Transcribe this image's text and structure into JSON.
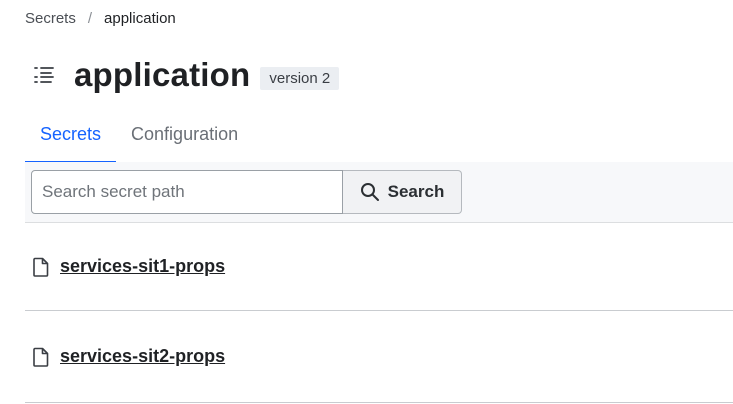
{
  "breadcrumb": {
    "root": "Secrets",
    "separator": "/",
    "current": "application"
  },
  "header": {
    "icon": "list-icon",
    "title": "application",
    "version_badge": "version 2"
  },
  "tabs": [
    {
      "label": "Secrets",
      "active": true
    },
    {
      "label": "Configuration",
      "active": false
    }
  ],
  "toolbar": {
    "search_placeholder": "Search secret path",
    "search_value": "",
    "search_button_label": "Search"
  },
  "secrets": [
    {
      "icon": "file-icon",
      "label": "services-sit1-props"
    },
    {
      "icon": "file-icon",
      "label": "services-sit2-props"
    }
  ],
  "colors": {
    "accent": "#1563ff",
    "text": "#1f2124",
    "muted": "#6a6f76",
    "toolbar_bg": "#f7f8fa",
    "badge_bg": "#ebeef2"
  }
}
